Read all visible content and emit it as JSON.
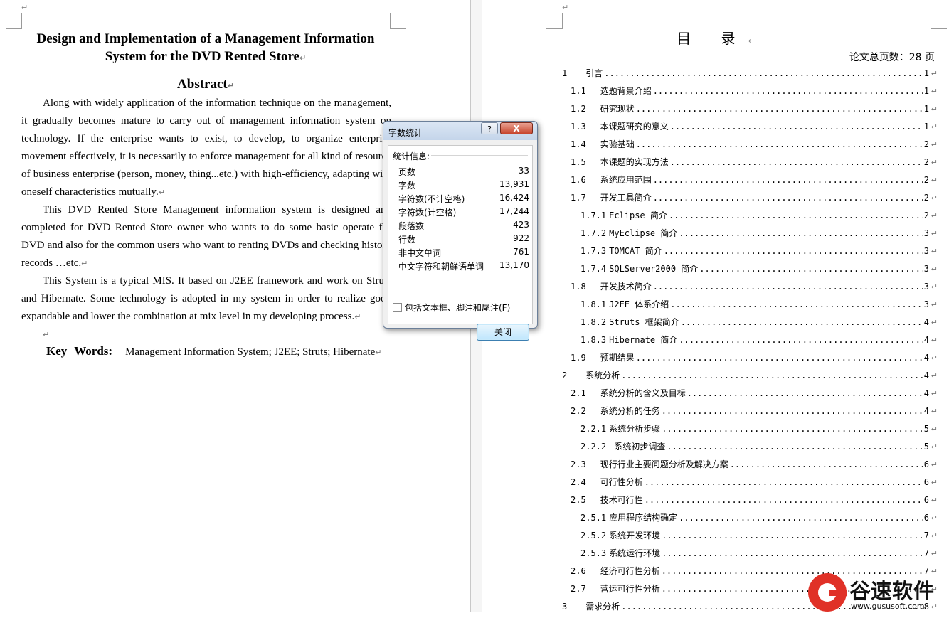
{
  "left_page": {
    "title_line1": "Design and Implementation of a Management Information",
    "title_line2": "System for the DVD Rented Store",
    "abstract_heading": "Abstract",
    "paragraphs": [
      "Along with widely application of the information technique on the management, it gradually becomes mature to carry out of management information system on technology. If the enterprise wants to exist, to develop, to organize enterprise movement effectively, it is necessarily to enforce management for all kind of resource of business enterprise (person, money, thing...etc.) with high-efficiency, adapting with oneself characteristics mutually.",
      "This DVD Rented Store Management information system is designed and completed for DVD Rented Store owner who wants to do some basic operate for DVD and also for the common users who want to renting DVDs and checking history records …etc.",
      "This System is a typical MIS. It based on J2EE framework and work on Struts and Hibernate. Some technology is adopted in my system in order to realize good expandable and lower the combination at mix level in my developing process."
    ],
    "keywords_label": "Key Words:",
    "keywords": "Management Information System; J2EE; Struts; Hibernate",
    "return_mark": "↵"
  },
  "right_page": {
    "toc_title": "目 录",
    "total_pages": "论文总页数：28 页",
    "toc": [
      {
        "num": "1",
        "label": "引言",
        "page": "1",
        "indent": 0
      },
      {
        "num": "1.1",
        "label": "选题背景介绍",
        "page": "1",
        "indent": 1
      },
      {
        "num": "1.2",
        "label": "研究现状",
        "page": "1",
        "indent": 1
      },
      {
        "num": "1.3",
        "label": "本课题研究的意义",
        "page": "1",
        "indent": 1
      },
      {
        "num": "1.4",
        "label": "实验基础",
        "page": "2",
        "indent": 1
      },
      {
        "num": "1.5",
        "label": "本课题的实现方法",
        "page": "2",
        "indent": 1
      },
      {
        "num": "1.6",
        "label": "系统应用范围",
        "page": "2",
        "indent": 1
      },
      {
        "num": "1.7",
        "label": "开发工具简介",
        "page": "2",
        "indent": 1
      },
      {
        "num": "1.7.1",
        "label": "Eclipse 简介",
        "page": "2",
        "indent": 2
      },
      {
        "num": "1.7.2",
        "label": "MyEclipse 简介",
        "page": "3",
        "indent": 2
      },
      {
        "num": "1.7.3",
        "label": "TOMCAT 简介",
        "page": "3",
        "indent": 2
      },
      {
        "num": "1.7.4",
        "label": "SQLServer2000 简介",
        "page": "3",
        "indent": 2
      },
      {
        "num": "1.8",
        "label": "开发技术简介",
        "page": "3",
        "indent": 1
      },
      {
        "num": "1.8.1",
        "label": "J2EE 体系介绍",
        "page": "3",
        "indent": 2
      },
      {
        "num": "1.8.2",
        "label": "Struts 框架简介",
        "page": "4",
        "indent": 2
      },
      {
        "num": "1.8.3",
        "label": "Hibernate 简介",
        "page": "4",
        "indent": 2
      },
      {
        "num": "1.9",
        "label": "预期结果",
        "page": "4",
        "indent": 1
      },
      {
        "num": "2",
        "label": "系统分析",
        "page": "4",
        "indent": 0
      },
      {
        "num": "2.1",
        "label": "系统分析的含义及目标",
        "page": "4",
        "indent": 1
      },
      {
        "num": "2.2",
        "label": "系统分析的任务",
        "page": "4",
        "indent": 1
      },
      {
        "num": "2.2.1",
        "label": "系统分析步骤",
        "page": "5",
        "indent": 2
      },
      {
        "num": "2.2.2",
        "label": " 系统初步调查",
        "page": "5",
        "indent": 2
      },
      {
        "num": "2.3",
        "label": "现行行业主要问题分析及解决方案",
        "page": "6",
        "indent": 1
      },
      {
        "num": "2.4",
        "label": "可行性分析",
        "page": "6",
        "indent": 1
      },
      {
        "num": "2.5",
        "label": "技术可行性",
        "page": "6",
        "indent": 1
      },
      {
        "num": "2.5.1",
        "label": "应用程序结构确定",
        "page": "6",
        "indent": 2
      },
      {
        "num": "2.5.2",
        "label": "系统开发环境",
        "page": "7",
        "indent": 2
      },
      {
        "num": "2.5.3",
        "label": "系统运行环境",
        "page": "7",
        "indent": 2
      },
      {
        "num": "2.6",
        "label": "经济可行性分析",
        "page": "7",
        "indent": 1
      },
      {
        "num": "2.7",
        "label": "营运可行性分析",
        "page": "7",
        "indent": 1
      },
      {
        "num": "3",
        "label": "需求分析",
        "page": "8",
        "indent": 0
      }
    ]
  },
  "dialog": {
    "title": "字数统计",
    "help_label": "?",
    "close_x": "X",
    "section_label": "统计信息:",
    "stats": [
      {
        "label": "页数",
        "value": "33"
      },
      {
        "label": "字数",
        "value": "13,931"
      },
      {
        "label": "字符数(不计空格)",
        "value": "16,424"
      },
      {
        "label": "字符数(计空格)",
        "value": "17,244"
      },
      {
        "label": "段落数",
        "value": "423"
      },
      {
        "label": "行数",
        "value": "922"
      },
      {
        "label": "非中文单词",
        "value": "761"
      },
      {
        "label": "中文字符和朝鲜语单词",
        "value": "13,170"
      }
    ],
    "checkbox_label": "包括文本框、脚注和尾注(F)",
    "checkbox_checked": false,
    "close_button": "关闭"
  },
  "watermark": {
    "text": "谷速软件",
    "url": "www.gususoft.com"
  },
  "colors": {
    "dialog_close": "#c7452d",
    "watermark_red": "#e03127",
    "button_border": "#3c7fb1"
  }
}
